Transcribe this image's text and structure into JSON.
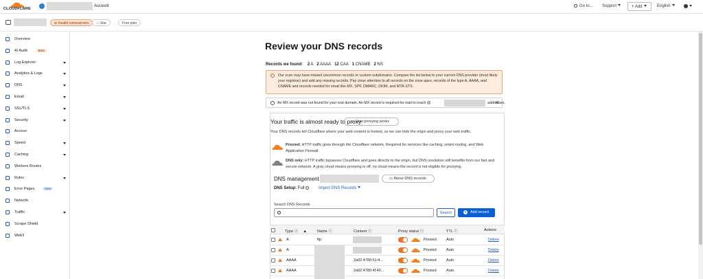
{
  "topbar": {
    "logo_text": "CLOUDFLARE",
    "account_label": "Account",
    "goto": "Go to...",
    "support": "Support",
    "add": "+ Add",
    "language": "English"
  },
  "zonebar": {
    "badge_invalid": "Invalid nameservers",
    "star": "Star",
    "plan": "Free plan"
  },
  "sidebar": {
    "items": [
      {
        "label": "Overview",
        "icon": "document-icon",
        "caret": false,
        "tag": ""
      },
      {
        "label": "AI Audit",
        "icon": "ai-audit-icon",
        "caret": false,
        "tag": "Beta"
      },
      {
        "label": "Log Explorer",
        "icon": "log-icon",
        "caret": true,
        "tag": ""
      },
      {
        "label": "Analytics & Logs",
        "icon": "chart-icon",
        "caret": true,
        "tag": ""
      },
      {
        "label": "DNS",
        "icon": "dns-icon",
        "caret": true,
        "tag": ""
      },
      {
        "label": "Email",
        "icon": "email-icon",
        "caret": true,
        "tag": ""
      },
      {
        "label": "SSL/TLS",
        "icon": "lock-icon",
        "caret": true,
        "tag": ""
      },
      {
        "label": "Security",
        "icon": "shield-icon",
        "caret": true,
        "tag": ""
      },
      {
        "label": "Access",
        "icon": "access-icon",
        "caret": false,
        "tag": ""
      },
      {
        "label": "Speed",
        "icon": "speed-icon",
        "caret": true,
        "tag": ""
      },
      {
        "label": "Caching",
        "icon": "caching-icon",
        "caret": true,
        "tag": ""
      },
      {
        "label": "Workers Routes",
        "icon": "workers-icon",
        "caret": false,
        "tag": ""
      },
      {
        "label": "Rules",
        "icon": "rules-icon",
        "caret": true,
        "tag": ""
      },
      {
        "label": "Error Pages",
        "icon": "error-pages-icon",
        "caret": false,
        "tag": "New"
      },
      {
        "label": "Network",
        "icon": "network-icon",
        "caret": false,
        "tag": ""
      },
      {
        "label": "Traffic",
        "icon": "traffic-icon",
        "caret": true,
        "tag": ""
      },
      {
        "label": "Scrape Shield",
        "icon": "scrape-shield-icon",
        "caret": false,
        "tag": ""
      },
      {
        "label": "Web3",
        "icon": "web3-icon",
        "caret": false,
        "tag": ""
      }
    ]
  },
  "main": {
    "title": "Review your DNS records",
    "records_found_label": "Records we found:",
    "record_counts": [
      {
        "count": "2",
        "type": "A"
      },
      {
        "count": "2",
        "type": "AAAA"
      },
      {
        "count": "12",
        "type": "CAA"
      },
      {
        "count": "1",
        "type": "CNAME"
      },
      {
        "count": "2",
        "type": "NS"
      }
    ],
    "warning_text": "Our scan may have missed uncommon records or custom subdomains. Compare the list below to your current DNS provider (most likely your registrar) and add any missing records. Pay close attention to all records on the zone apex, records of the type A, AAAA, and CNAME and records needed for email like MX, SPF, DMARC, DKIM, and MTA-STS.",
    "info_text": "An MX record was not found for your root domain. An MX record is required for mail to reach @",
    "info_text_end": "addresses.",
    "proxy_title": "Your traffic is almost ready to proxy",
    "how_proxying": "How proxying works",
    "proxy_desc": "Your DNS records tell Cloudflare where your web content is hosted, so we can hide the origin and proxy your web traffic.",
    "proxied_label": "Proxied:",
    "proxied_text": " HTTP traffic goes through the Cloudflare network. Required for services like caching, smart routing, and Web Application Firewall.",
    "dnsonly_label": "DNS only:",
    "dnsonly_text": " HTTP traffic bypasses Cloudflare and goes directly to the origin, but DNS resolution still benefits from our fast and secure network. A gray cloud means proxying is off, no cloud means the record is not eligible for proxying.",
    "mgmt_label": "DNS management for",
    "about_dns": "About DNS records",
    "setup_label": "DNS Setup:",
    "setup_value": "Full",
    "import_label": "Import DNS Records",
    "search_label": "Search DNS Records",
    "search_placeholder": "",
    "search_button": "Search",
    "add_record": "Add record"
  },
  "table": {
    "headers": {
      "type": "Type",
      "name": "Name",
      "content": "Content",
      "proxy": "Proxy status",
      "ttl": "TTL",
      "actions": "Actions"
    },
    "rows": [
      {
        "type": "A",
        "name": "ftp",
        "content": "",
        "proxy": "Proxied",
        "ttl": "Auto",
        "action": "Delete"
      },
      {
        "type": "A",
        "name": "",
        "content": "",
        "proxy": "Proxied",
        "ttl": "Auto",
        "action": "Delete"
      },
      {
        "type": "AAAA",
        "name": "",
        "content": "2a02:4780:51:4...",
        "proxy": "Proxied",
        "ttl": "Auto",
        "action": "Delete"
      },
      {
        "type": "AAAA",
        "name": "",
        "content": "2a02:4780:4f:40...",
        "proxy": "Proxied",
        "ttl": "Auto",
        "action": "Delete"
      }
    ]
  },
  "colors": {
    "accent": "#0a5ed7",
    "orange": "#f38020",
    "warning_bg": "#fcecdf"
  }
}
